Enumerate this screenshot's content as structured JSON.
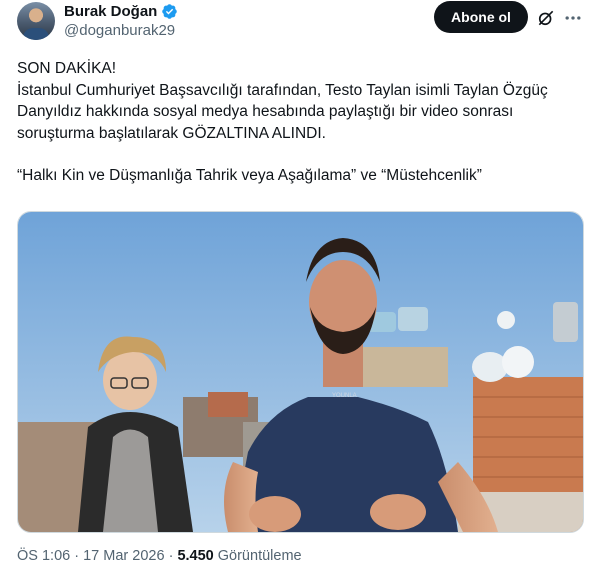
{
  "author": {
    "name": "Burak Doğan",
    "handle": "@doganburak29",
    "verified": true
  },
  "actions": {
    "follow_label": "Abone ol",
    "grok_icon": "grok-icon",
    "more_icon": "more-icon"
  },
  "tweet": {
    "line1": "SON DAKİKA!",
    "line2": "İstanbul Cumhuriyet Başsavcılığı tarafından, Testo Taylan isimli Taylan Özgüç Danyıldız hakkında sosyal medya hesabında paylaştığı bir video sonrası soruşturma başlatılarak GÖZALTINA ALINDI.",
    "line3": "“Halkı Kin ve Düşmanlığa Tahrik veya Aşağılama” ve “Müstehcenlik”"
  },
  "media": {
    "shirt_text": "YOUNLA"
  },
  "meta": {
    "time": "ÖS 1:06",
    "separator": "·",
    "date": "17 Mar 2026",
    "views_count": "5.450",
    "views_label": "Görüntüleme"
  },
  "colors": {
    "verified_blue": "#1d9bf0",
    "text_primary": "#0f1419",
    "text_secondary": "#536471"
  }
}
